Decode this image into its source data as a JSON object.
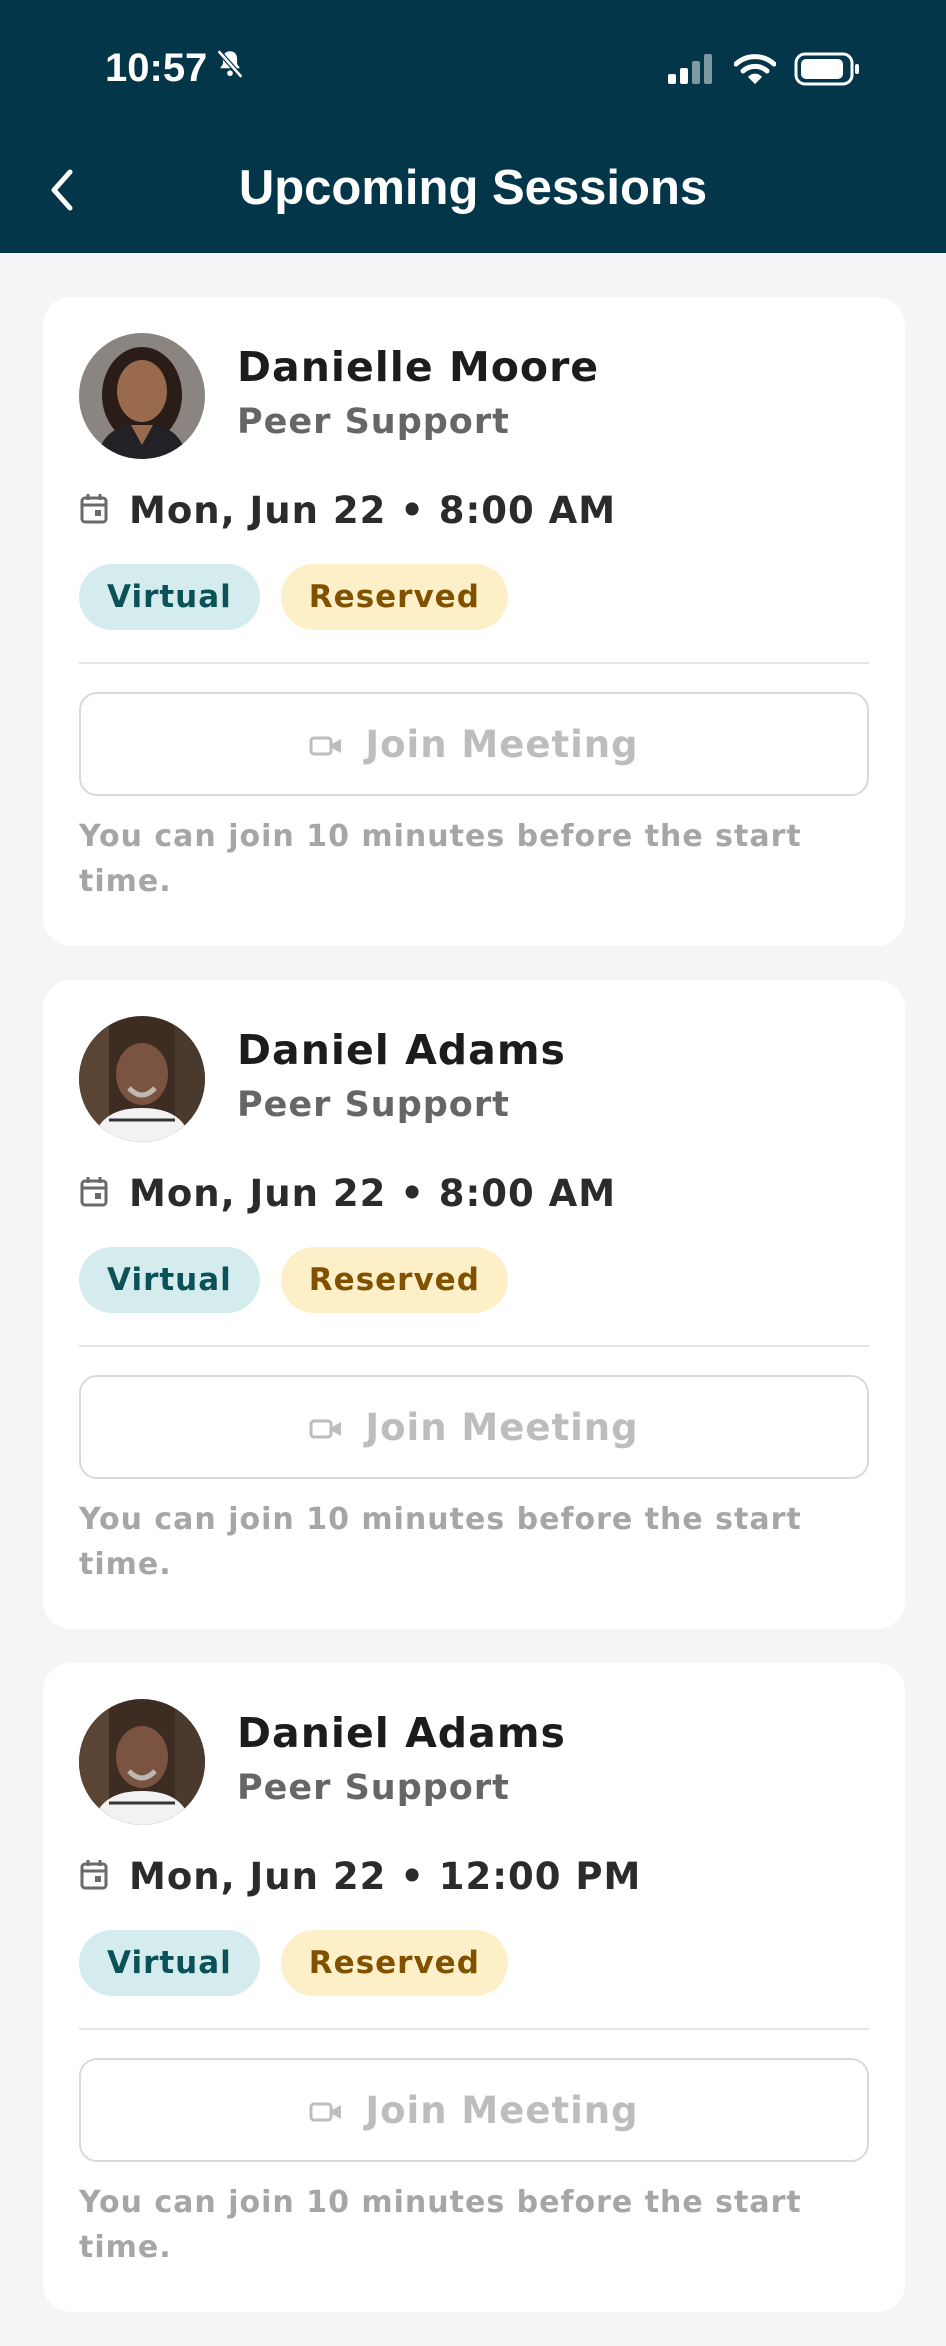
{
  "status_bar": {
    "time": "10:57"
  },
  "header": {
    "title": "Upcoming Sessions"
  },
  "sessions": [
    {
      "name": "Danielle Moore",
      "role": "Peer Support",
      "datetime": "Mon, Jun 22 • 8:00 AM",
      "chips": [
        "Virtual",
        "Reserved"
      ],
      "join_label": "Join Meeting",
      "note": "You can join 10 minutes before the start time."
    },
    {
      "name": "Daniel Adams",
      "role": "Peer Support",
      "datetime": "Mon, Jun 22 • 8:00 AM",
      "chips": [
        "Virtual",
        "Reserved"
      ],
      "join_label": "Join Meeting",
      "note": "You can join 10 minutes before the start time."
    },
    {
      "name": "Daniel Adams",
      "role": "Peer Support",
      "datetime": "Mon, Jun 22 • 12:00 PM",
      "chips": [
        "Virtual",
        "Reserved"
      ],
      "join_label": "Join Meeting",
      "note": "You can join 10 minutes before the start time."
    }
  ],
  "colors": {
    "header_bg": "#023648",
    "virtual_chip": "#d5ecee",
    "reserved_chip": "#fdf0c8"
  }
}
